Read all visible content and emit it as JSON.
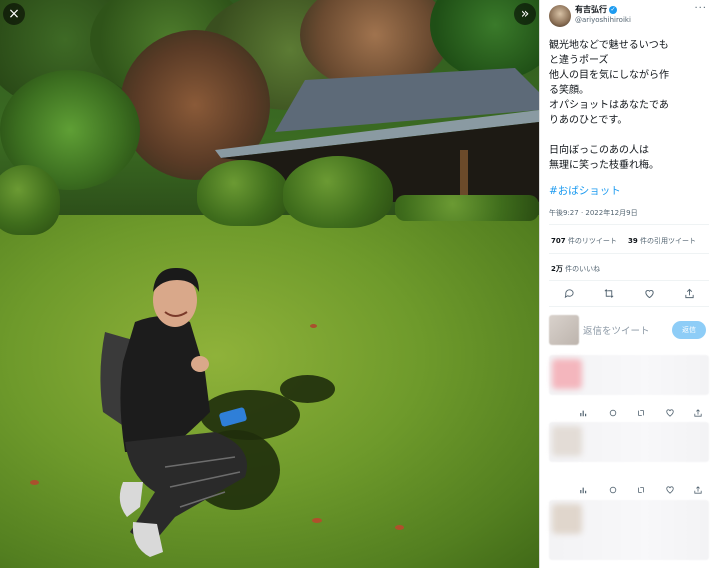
{
  "viewer": {
    "close_label": "×",
    "expand_label": "»"
  },
  "tweet": {
    "author_name": "有吉弘行",
    "author_handle": "@ariyoshihiroiki",
    "more_label": "···",
    "body_lines": [
      "観光地などで魅せるいつも",
      "と違うポーズ",
      "他人の目を気にしながら作",
      "る笑顔。",
      "オパショットはあなたであ",
      "りあのひとです。",
      "",
      "日向ぼっこのあの人は",
      "無理に笑った枝垂れ梅。"
    ],
    "hashtag": "#おばショット",
    "timestamp": "午後9:27 · 2022年12月9日",
    "retweets_count": "707",
    "retweets_label": "件のリツイート",
    "quotes_count": "39",
    "quotes_label": "件の引用ツイート",
    "likes_count": "2万",
    "likes_label": "件のいいね",
    "actions": [
      "reply-icon",
      "retweet-icon",
      "like-icon",
      "share-icon"
    ]
  },
  "reply": {
    "placeholder": "返信をツイート",
    "button_label": "返信"
  },
  "colors": {
    "accent": "#1d9bf0",
    "reply_button": "#8ecdf7",
    "text": "#0f1419",
    "muted": "#536471"
  }
}
